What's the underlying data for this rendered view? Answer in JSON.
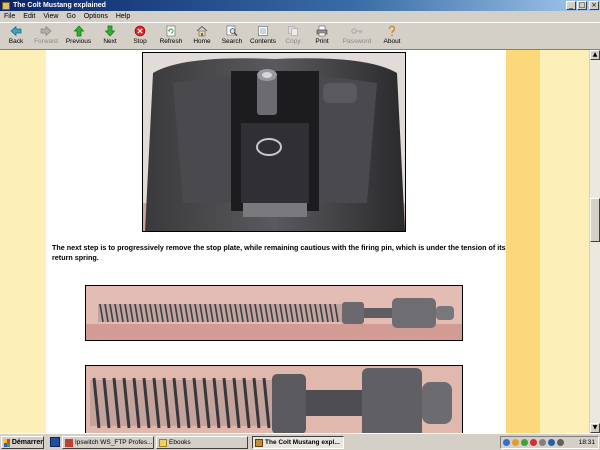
{
  "window": {
    "title": "The Colt Mustang explained",
    "minimize": "_",
    "maximize": "□",
    "close": "×"
  },
  "menu": [
    "File",
    "Edit",
    "View",
    "Go",
    "Options",
    "Help"
  ],
  "toolbar": [
    {
      "label": "Back",
      "icon": "back-arrow-icon",
      "enabled": true
    },
    {
      "label": "Forward",
      "icon": "forward-arrow-icon",
      "enabled": false
    },
    {
      "label": "Previous",
      "icon": "up-arrow-icon",
      "enabled": true
    },
    {
      "label": "Next",
      "icon": "down-arrow-icon",
      "enabled": true
    },
    {
      "label": "Stop",
      "icon": "stop-icon",
      "enabled": true
    },
    {
      "label": "Refresh",
      "icon": "refresh-icon",
      "enabled": true
    },
    {
      "label": "Home",
      "icon": "home-icon",
      "enabled": true
    },
    {
      "label": "Search",
      "icon": "search-icon",
      "enabled": true
    },
    {
      "label": "Contents",
      "icon": "contents-icon",
      "enabled": true
    },
    {
      "label": "Copy",
      "icon": "copy-icon",
      "enabled": false
    },
    {
      "label": "Print",
      "icon": "print-icon",
      "enabled": true
    },
    {
      "label": "Password",
      "icon": "key-icon",
      "enabled": false
    },
    {
      "label": "About",
      "icon": "about-icon",
      "enabled": true
    }
  ],
  "page": {
    "caption": "The next step is to progressively remove the stop plate, while remaining cautious with the firing pin, which is under the tension of its return spring."
  },
  "taskbar": {
    "start_label": "Démarrer",
    "tasks": [
      {
        "label": "Ipswitch WS_FTP Profes...",
        "active": false
      },
      {
        "label": "Ebooks",
        "active": false
      },
      {
        "label": "The Colt Mustang expl...",
        "active": true
      }
    ],
    "clock": "18:31"
  },
  "colors": {
    "titlebar": "#0a246a",
    "page_background": "#fcefb8",
    "band_gold": "#fbd97a",
    "content_background": "#ffffff"
  }
}
